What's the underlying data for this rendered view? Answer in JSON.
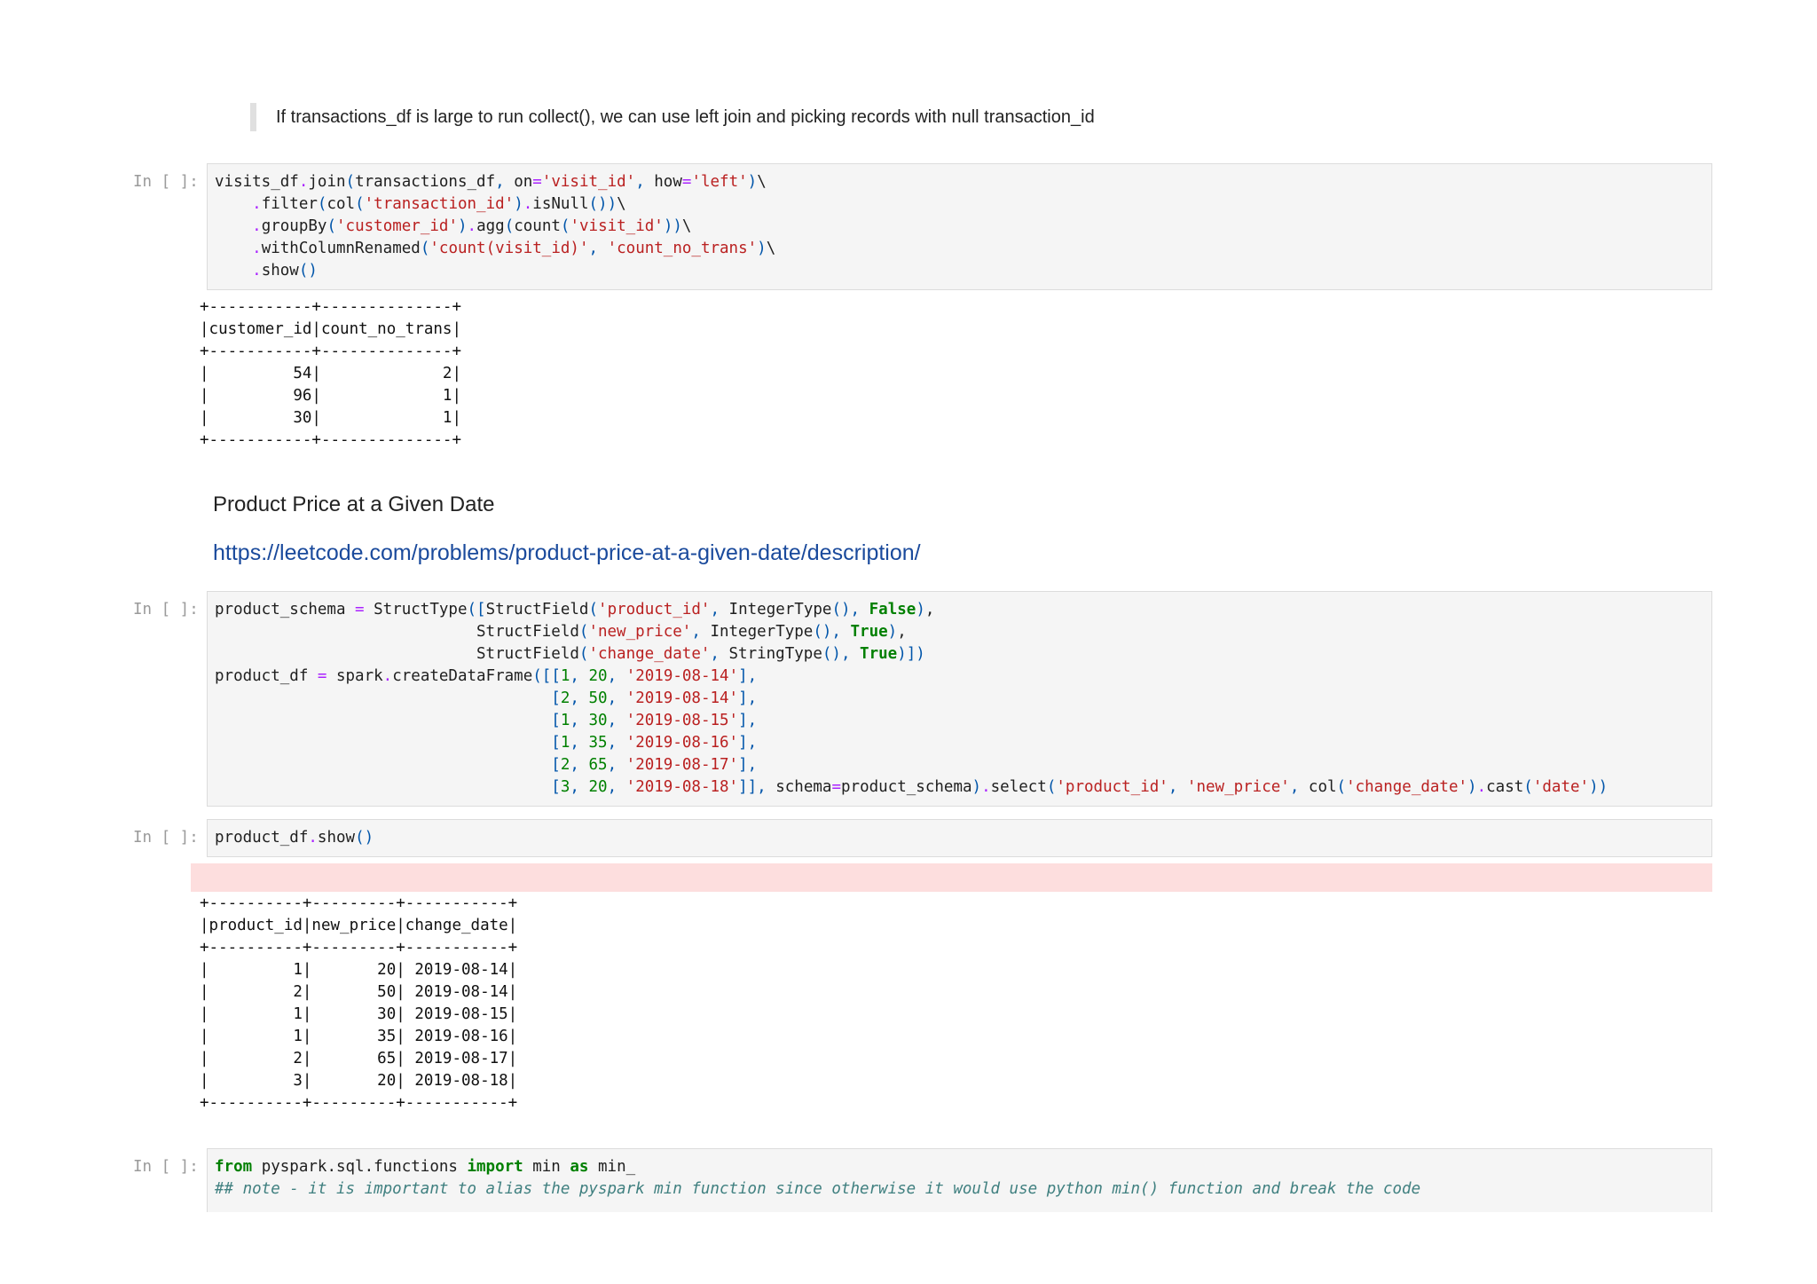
{
  "markdown_note": "If transactions_df is large to run collect(), we can use left join and picking records with null transaction_id",
  "prompt_label": "In [ ]:",
  "cell1": {
    "lines": [
      [
        [
          "t",
          "visits_df"
        ],
        [
          "o",
          "."
        ],
        [
          "t",
          "join"
        ],
        [
          "p",
          "("
        ],
        [
          "t",
          "transactions_df"
        ],
        [
          "p",
          ","
        ],
        [
          "t",
          " on"
        ],
        [
          "o",
          "="
        ],
        [
          "s",
          "'visit_id'"
        ],
        [
          "p",
          ","
        ],
        [
          "t",
          " how"
        ],
        [
          "o",
          "="
        ],
        [
          "s",
          "'left'"
        ],
        [
          "p",
          ")"
        ],
        [
          "t",
          "\\"
        ]
      ],
      [
        [
          "t",
          "    "
        ],
        [
          "o",
          "."
        ],
        [
          "t",
          "filter"
        ],
        [
          "p",
          "("
        ],
        [
          "t",
          "col"
        ],
        [
          "p",
          "("
        ],
        [
          "s",
          "'transaction_id'"
        ],
        [
          "p",
          ")"
        ],
        [
          "o",
          "."
        ],
        [
          "t",
          "isNull"
        ],
        [
          "p",
          "())"
        ],
        [
          "t",
          "\\"
        ]
      ],
      [
        [
          "t",
          "    "
        ],
        [
          "o",
          "."
        ],
        [
          "t",
          "groupBy"
        ],
        [
          "p",
          "("
        ],
        [
          "s",
          "'customer_id'"
        ],
        [
          "p",
          ")"
        ],
        [
          "o",
          "."
        ],
        [
          "t",
          "agg"
        ],
        [
          "p",
          "("
        ],
        [
          "t",
          "count"
        ],
        [
          "p",
          "("
        ],
        [
          "s",
          "'visit_id'"
        ],
        [
          "p",
          "))"
        ],
        [
          "t",
          "\\"
        ]
      ],
      [
        [
          "t",
          "    "
        ],
        [
          "o",
          "."
        ],
        [
          "t",
          "withColumnRenamed"
        ],
        [
          "p",
          "("
        ],
        [
          "s",
          "'count(visit_id)'"
        ],
        [
          "p",
          ","
        ],
        [
          "t",
          " "
        ],
        [
          "s",
          "'count_no_trans'"
        ],
        [
          "p",
          ")"
        ],
        [
          "t",
          "\\"
        ]
      ],
      [
        [
          "t",
          "    "
        ],
        [
          "o",
          "."
        ],
        [
          "t",
          "show"
        ],
        [
          "p",
          "()"
        ]
      ]
    ]
  },
  "output1": [
    "+-----------+--------------+",
    "|customer_id|count_no_trans|",
    "+-----------+--------------+",
    "|         54|             2|",
    "|         96|             1|",
    "|         30|             1|",
    "+-----------+--------------+"
  ],
  "heading": "Product Price at a Given Date",
  "link": "https://leetcode.com/problems/product-price-at-a-given-date/description/",
  "cell2": {
    "lines": [
      [
        [
          "t",
          "product_schema "
        ],
        [
          "o",
          "="
        ],
        [
          "t",
          " StructType"
        ],
        [
          "p",
          "(["
        ],
        [
          "t",
          "StructField"
        ],
        [
          "p",
          "("
        ],
        [
          "s",
          "'product_id'"
        ],
        [
          "p",
          ","
        ],
        [
          "t",
          " IntegerType"
        ],
        [
          "p",
          "()"
        ],
        [
          "p",
          ","
        ],
        [
          "t",
          " "
        ],
        [
          "k",
          "False"
        ],
        [
          "p",
          ")"
        ],
        [
          "t",
          ","
        ]
      ],
      [
        [
          "t",
          "                            StructField"
        ],
        [
          "p",
          "("
        ],
        [
          "s",
          "'new_price'"
        ],
        [
          "p",
          ","
        ],
        [
          "t",
          " IntegerType"
        ],
        [
          "p",
          "()"
        ],
        [
          "p",
          ","
        ],
        [
          "t",
          " "
        ],
        [
          "k",
          "True"
        ],
        [
          "p",
          ")"
        ],
        [
          "t",
          ","
        ]
      ],
      [
        [
          "t",
          "                            StructField"
        ],
        [
          "p",
          "("
        ],
        [
          "s",
          "'change_date'"
        ],
        [
          "p",
          ","
        ],
        [
          "t",
          " StringType"
        ],
        [
          "p",
          "()"
        ],
        [
          "p",
          ","
        ],
        [
          "t",
          " "
        ],
        [
          "k",
          "True"
        ],
        [
          "p",
          ")])"
        ]
      ],
      [
        [
          "t",
          "product_df "
        ],
        [
          "o",
          "="
        ],
        [
          "t",
          " spark"
        ],
        [
          "o",
          "."
        ],
        [
          "t",
          "createDataFrame"
        ],
        [
          "p",
          "([["
        ],
        [
          "n",
          "1"
        ],
        [
          "p",
          ","
        ],
        [
          "t",
          " "
        ],
        [
          "n",
          "20"
        ],
        [
          "p",
          ","
        ],
        [
          "t",
          " "
        ],
        [
          "s",
          "'2019-08-14'"
        ],
        [
          "p",
          "],"
        ]
      ],
      [
        [
          "t",
          "                                    "
        ],
        [
          "p",
          "["
        ],
        [
          "n",
          "2"
        ],
        [
          "p",
          ","
        ],
        [
          "t",
          " "
        ],
        [
          "n",
          "50"
        ],
        [
          "p",
          ","
        ],
        [
          "t",
          " "
        ],
        [
          "s",
          "'2019-08-14'"
        ],
        [
          "p",
          "],"
        ]
      ],
      [
        [
          "t",
          "                                    "
        ],
        [
          "p",
          "["
        ],
        [
          "n",
          "1"
        ],
        [
          "p",
          ","
        ],
        [
          "t",
          " "
        ],
        [
          "n",
          "30"
        ],
        [
          "p",
          ","
        ],
        [
          "t",
          " "
        ],
        [
          "s",
          "'2019-08-15'"
        ],
        [
          "p",
          "],"
        ]
      ],
      [
        [
          "t",
          "                                    "
        ],
        [
          "p",
          "["
        ],
        [
          "n",
          "1"
        ],
        [
          "p",
          ","
        ],
        [
          "t",
          " "
        ],
        [
          "n",
          "35"
        ],
        [
          "p",
          ","
        ],
        [
          "t",
          " "
        ],
        [
          "s",
          "'2019-08-16'"
        ],
        [
          "p",
          "],"
        ]
      ],
      [
        [
          "t",
          "                                    "
        ],
        [
          "p",
          "["
        ],
        [
          "n",
          "2"
        ],
        [
          "p",
          ","
        ],
        [
          "t",
          " "
        ],
        [
          "n",
          "65"
        ],
        [
          "p",
          ","
        ],
        [
          "t",
          " "
        ],
        [
          "s",
          "'2019-08-17'"
        ],
        [
          "p",
          "],"
        ]
      ],
      [
        [
          "t",
          "                                    "
        ],
        [
          "p",
          "["
        ],
        [
          "n",
          "3"
        ],
        [
          "p",
          ","
        ],
        [
          "t",
          " "
        ],
        [
          "n",
          "20"
        ],
        [
          "p",
          ","
        ],
        [
          "t",
          " "
        ],
        [
          "s",
          "'2019-08-18'"
        ],
        [
          "p",
          "]],"
        ],
        [
          "t",
          " schema"
        ],
        [
          "o",
          "="
        ],
        [
          "t",
          "product_schema"
        ],
        [
          "p",
          ")"
        ],
        [
          "o",
          "."
        ],
        [
          "t",
          "select"
        ],
        [
          "p",
          "("
        ],
        [
          "s",
          "'product_id'"
        ],
        [
          "p",
          ","
        ],
        [
          "t",
          " "
        ],
        [
          "s",
          "'new_price'"
        ],
        [
          "p",
          ","
        ],
        [
          "t",
          " col"
        ],
        [
          "p",
          "("
        ],
        [
          "s",
          "'change_date'"
        ],
        [
          "p",
          ")"
        ],
        [
          "o",
          "."
        ],
        [
          "t",
          "cast"
        ],
        [
          "p",
          "("
        ],
        [
          "s",
          "'date'"
        ],
        [
          "p",
          "))"
        ]
      ]
    ]
  },
  "cell3": {
    "lines": [
      [
        [
          "t",
          "product_df"
        ],
        [
          "o",
          "."
        ],
        [
          "t",
          "show"
        ],
        [
          "p",
          "()"
        ]
      ]
    ]
  },
  "output3": [
    "+----------+---------+-----------+",
    "|product_id|new_price|change_date|",
    "+----------+---------+-----------+",
    "|         1|       20| 2019-08-14|",
    "|         2|       50| 2019-08-14|",
    "|         1|       30| 2019-08-15|",
    "|         1|       35| 2019-08-16|",
    "|         2|       65| 2019-08-17|",
    "|         3|       20| 2019-08-18|",
    "+----------+---------+-----------+"
  ],
  "cell4": {
    "lines": [
      [
        [
          "k",
          "from"
        ],
        [
          "t",
          " pyspark.sql.functions "
        ],
        [
          "k",
          "import"
        ],
        [
          "t",
          " min "
        ],
        [
          "k",
          "as"
        ],
        [
          "t",
          " min_"
        ]
      ],
      [
        [
          "c",
          "## note - it is important to alias the pyspark min function since otherwise it would use python min() function and break the code"
        ]
      ]
    ]
  }
}
